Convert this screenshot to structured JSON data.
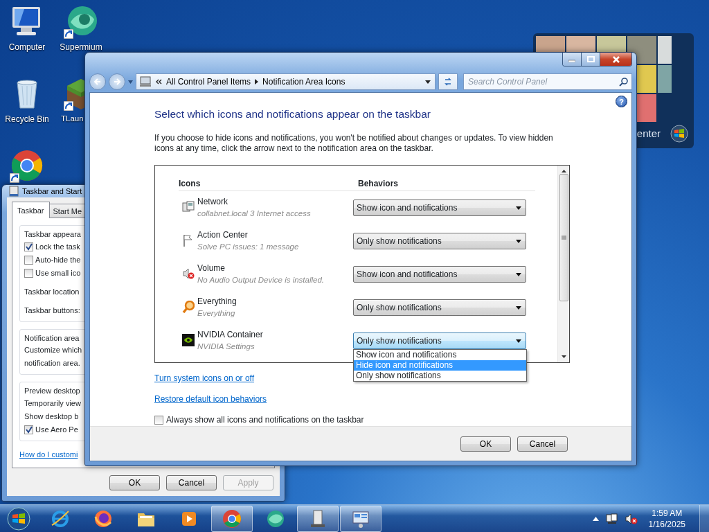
{
  "desktop_icons": [
    {
      "kind": "computer",
      "label": "Computer",
      "shortcut": false
    },
    {
      "kind": "supermium",
      "label": "Supermium",
      "shortcut": true
    },
    {
      "kind": "recycle",
      "label": "Recycle Bin",
      "shortcut": false
    },
    {
      "kind": "blocks",
      "label": "TLaun",
      "shortcut": true
    },
    {
      "kind": "chrome",
      "shortcut": true
    }
  ],
  "gadget": {
    "label": "enter"
  },
  "background_dialog": {
    "title": "Taskbar and Start",
    "tabs": [
      {
        "label": "Taskbar",
        "selected": true
      },
      {
        "label": "Start Me",
        "selected": false
      }
    ],
    "groups": [
      {
        "legend": "Taskbar appeara",
        "items": [
          {
            "kind": "checkbox",
            "label": "Lock the task",
            "checked": true
          },
          {
            "kind": "checkbox",
            "label": "Auto-hide the",
            "checked": false
          },
          {
            "kind": "checkbox",
            "label": "Use small ico",
            "checked": false
          },
          {
            "kind": "text",
            "label": "Taskbar location"
          },
          {
            "kind": "text",
            "label": "Taskbar buttons:"
          }
        ]
      },
      {
        "legend": "Notification area",
        "items": [
          {
            "kind": "text",
            "label": "Customize which"
          },
          {
            "kind": "text",
            "label": "notification area."
          }
        ]
      },
      {
        "legend": "Preview desktop",
        "items": [
          {
            "kind": "text",
            "label": "Temporarily view"
          },
          {
            "kind": "text",
            "label": "Show desktop b"
          },
          {
            "kind": "checkbox",
            "label": "Use Aero Pe",
            "checked": true
          }
        ]
      }
    ],
    "help_link": "How do I customi",
    "buttons": [
      {
        "label": "OK",
        "disabled": false
      },
      {
        "label": "Cancel",
        "disabled": false
      },
      {
        "label": "Apply",
        "disabled": true
      }
    ]
  },
  "main_window": {
    "address": [
      "All Control Panel Items",
      "Notification Area Icons"
    ],
    "search": {
      "placeholder": "Search Control Panel"
    },
    "help": "?",
    "heading": "Select which icons and notifications appear on the taskbar",
    "description": "If you choose to hide icons and notifications, you won't be notified about changes or updates. To view hidden icons at any time, click the arrow next to the notification area on the taskbar.",
    "columns": [
      "Icons",
      "Behaviors"
    ],
    "rows": [
      {
        "kind": "network",
        "name": "Network",
        "detail": "collabnet.local  3 Internet access",
        "behavior": "Show icon and notifications",
        "focused": false
      },
      {
        "kind": "flag",
        "name": "Action Center",
        "detail": "Solve PC issues: 1 message",
        "behavior": "Only show notifications",
        "focused": false
      },
      {
        "kind": "volume",
        "name": "Volume",
        "detail": "No Audio Output Device is installed.",
        "behavior": "Show icon and notifications",
        "focused": false
      },
      {
        "kind": "magnifier",
        "name": "Everything",
        "detail": "Everything",
        "behavior": "Only show notifications",
        "focused": false
      },
      {
        "kind": "nvidia",
        "name": "NVIDIA Container",
        "detail": "NVIDIA Settings",
        "behavior": "Only show notifications",
        "focused": true
      }
    ],
    "dropdown_options": [
      {
        "label": "Show icon and notifications",
        "selected": false
      },
      {
        "label": "Hide icon and notifications",
        "selected": true
      },
      {
        "label": "Only show notifications",
        "selected": false
      }
    ],
    "links": [
      "Turn system icons on or off",
      "Restore default icon behaviors"
    ],
    "always_show": {
      "label": "Always show all icons and notifications on the taskbar",
      "checked": false
    },
    "buttons": [
      "OK",
      "Cancel"
    ]
  },
  "taskbar": {
    "items": [
      {
        "kind": "ie",
        "active": false
      },
      {
        "kind": "firefox",
        "active": false
      },
      {
        "kind": "folder",
        "active": false
      },
      {
        "kind": "media",
        "active": false
      },
      {
        "kind": "chrome",
        "active": true
      },
      {
        "kind": "supermium",
        "active": false
      },
      {
        "kind": "computer",
        "active": true
      },
      {
        "kind": "control",
        "active": true
      }
    ],
    "time": "1:59 AM",
    "date": "1/16/2025"
  }
}
